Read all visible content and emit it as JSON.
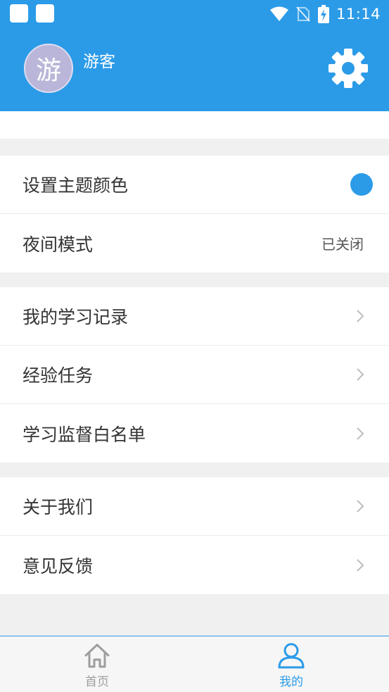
{
  "status_bar": {
    "time": "11:14"
  },
  "profile": {
    "avatar_char": "游",
    "username": "游客"
  },
  "settings_group": [
    {
      "label": "设置主题颜色",
      "theme_color": "#2b9be8"
    },
    {
      "label": "夜间模式",
      "value": "已关闭"
    }
  ],
  "study_group": [
    {
      "label": "我的学习记录"
    },
    {
      "label": "经验任务"
    },
    {
      "label": "学习监督白名单"
    }
  ],
  "about_group": [
    {
      "label": "关于我们"
    },
    {
      "label": "意见反馈"
    }
  ],
  "bottom_nav": [
    {
      "label": "首页",
      "active": false
    },
    {
      "label": "我的",
      "active": true
    }
  ],
  "colors": {
    "primary": "#2b9be8",
    "inactive": "#9e9e9e"
  }
}
